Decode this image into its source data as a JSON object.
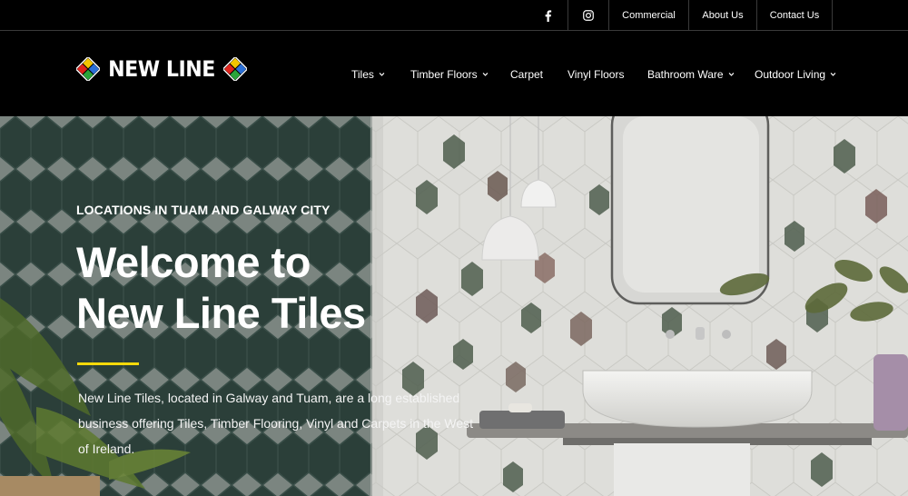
{
  "topbar": {
    "facebook_icon": "facebook-icon",
    "instagram_icon": "instagram-icon",
    "links": [
      "Commercial",
      "About Us",
      "Contact Us"
    ]
  },
  "logo": {
    "text": "NEW LINE"
  },
  "nav": [
    {
      "label": "Tiles",
      "dropdown": true
    },
    {
      "label": "Timber Floors",
      "dropdown": true
    },
    {
      "label": "Carpet",
      "dropdown": false
    },
    {
      "label": "Vinyl Floors",
      "dropdown": false
    },
    {
      "label": "Bathroom Ware",
      "dropdown": true
    },
    {
      "label": "Outdoor Living",
      "dropdown": true
    }
  ],
  "hero": {
    "eyebrow": "LOCATIONS IN TUAM AND GALWAY CITY",
    "title_line1": "Welcome to",
    "title_line2": "New Line Tiles",
    "description": "New Line Tiles, located in Galway and  Tuam, are a long established business offering Tiles, Timber Flooring, Vinyl and Carpets in the West of Ireland."
  },
  "colors": {
    "background": "#000000",
    "accent_yellow": "#f5d90a",
    "hero_overlay_green": "#344a45"
  }
}
